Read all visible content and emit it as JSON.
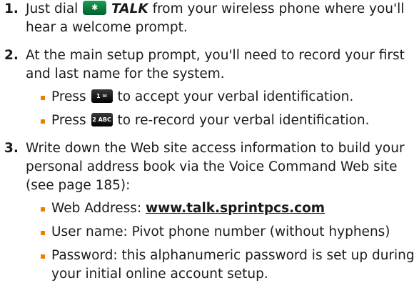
{
  "steps": [
    {
      "number": "1.",
      "text_before_key": "Just dial ",
      "key_icon": "star-key-icon",
      "key_glyph": "✱",
      "talk_label": "TALK",
      "text_after_key": " from your wireless phone where you'll hear a welcome prompt."
    },
    {
      "number": "2.",
      "text": "At the main setup prompt, you'll need to record your first and last name for the system.",
      "bullets": [
        {
          "before": "Press ",
          "key_icon": "one-key-icon",
          "key_glyph": "1 ✉",
          "after": " to accept your verbal identification."
        },
        {
          "before": "Press ",
          "key_icon": "two-key-icon",
          "key_glyph": "2 ABC",
          "after": " to re-record your verbal identification."
        }
      ]
    },
    {
      "number": "3.",
      "text": "Write down the Web site access information to build your personal address book via the Voice Command Web site (see page 185):",
      "bullets": [
        {
          "label": "Web Address: ",
          "link": "www.talk.sprintpcs.com"
        },
        {
          "text": "User name: Pivot phone number (without hyphens)"
        },
        {
          "text": "Password: this alphanumeric password is set up during your initial online account setup."
        }
      ]
    }
  ],
  "colors": {
    "bullet": "#f07d00",
    "talk_key": "#0a8a45",
    "number_key": "#111111"
  }
}
